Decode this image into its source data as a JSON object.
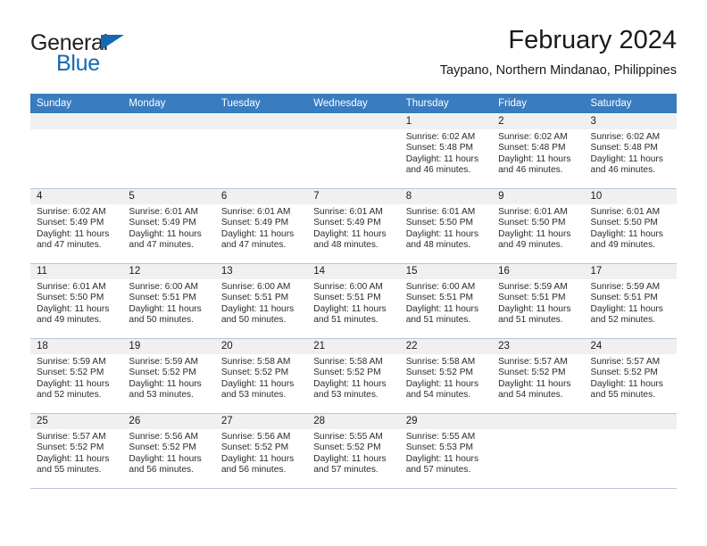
{
  "brand": {
    "name_part1": "General",
    "name_part2": "Blue",
    "triangle_icon": "brand-triangle-icon",
    "accent_color": "#1569b0"
  },
  "header": {
    "title": "February 2024",
    "subtitle": "Taypano, Northern Mindanao, Philippines"
  },
  "calendar": {
    "header_bg": "#3a7cc0",
    "daynum_bg": "#f0f0f0",
    "weekdays": [
      "Sunday",
      "Monday",
      "Tuesday",
      "Wednesday",
      "Thursday",
      "Friday",
      "Saturday"
    ],
    "weeks": [
      [
        {
          "day": "",
          "sunrise": "",
          "sunset": "",
          "daylight1": "",
          "daylight2": ""
        },
        {
          "day": "",
          "sunrise": "",
          "sunset": "",
          "daylight1": "",
          "daylight2": ""
        },
        {
          "day": "",
          "sunrise": "",
          "sunset": "",
          "daylight1": "",
          "daylight2": ""
        },
        {
          "day": "",
          "sunrise": "",
          "sunset": "",
          "daylight1": "",
          "daylight2": ""
        },
        {
          "day": "1",
          "sunrise": "Sunrise: 6:02 AM",
          "sunset": "Sunset: 5:48 PM",
          "daylight1": "Daylight: 11 hours",
          "daylight2": "and 46 minutes."
        },
        {
          "day": "2",
          "sunrise": "Sunrise: 6:02 AM",
          "sunset": "Sunset: 5:48 PM",
          "daylight1": "Daylight: 11 hours",
          "daylight2": "and 46 minutes."
        },
        {
          "day": "3",
          "sunrise": "Sunrise: 6:02 AM",
          "sunset": "Sunset: 5:48 PM",
          "daylight1": "Daylight: 11 hours",
          "daylight2": "and 46 minutes."
        }
      ],
      [
        {
          "day": "4",
          "sunrise": "Sunrise: 6:02 AM",
          "sunset": "Sunset: 5:49 PM",
          "daylight1": "Daylight: 11 hours",
          "daylight2": "and 47 minutes."
        },
        {
          "day": "5",
          "sunrise": "Sunrise: 6:01 AM",
          "sunset": "Sunset: 5:49 PM",
          "daylight1": "Daylight: 11 hours",
          "daylight2": "and 47 minutes."
        },
        {
          "day": "6",
          "sunrise": "Sunrise: 6:01 AM",
          "sunset": "Sunset: 5:49 PM",
          "daylight1": "Daylight: 11 hours",
          "daylight2": "and 47 minutes."
        },
        {
          "day": "7",
          "sunrise": "Sunrise: 6:01 AM",
          "sunset": "Sunset: 5:49 PM",
          "daylight1": "Daylight: 11 hours",
          "daylight2": "and 48 minutes."
        },
        {
          "day": "8",
          "sunrise": "Sunrise: 6:01 AM",
          "sunset": "Sunset: 5:50 PM",
          "daylight1": "Daylight: 11 hours",
          "daylight2": "and 48 minutes."
        },
        {
          "day": "9",
          "sunrise": "Sunrise: 6:01 AM",
          "sunset": "Sunset: 5:50 PM",
          "daylight1": "Daylight: 11 hours",
          "daylight2": "and 49 minutes."
        },
        {
          "day": "10",
          "sunrise": "Sunrise: 6:01 AM",
          "sunset": "Sunset: 5:50 PM",
          "daylight1": "Daylight: 11 hours",
          "daylight2": "and 49 minutes."
        }
      ],
      [
        {
          "day": "11",
          "sunrise": "Sunrise: 6:01 AM",
          "sunset": "Sunset: 5:50 PM",
          "daylight1": "Daylight: 11 hours",
          "daylight2": "and 49 minutes."
        },
        {
          "day": "12",
          "sunrise": "Sunrise: 6:00 AM",
          "sunset": "Sunset: 5:51 PM",
          "daylight1": "Daylight: 11 hours",
          "daylight2": "and 50 minutes."
        },
        {
          "day": "13",
          "sunrise": "Sunrise: 6:00 AM",
          "sunset": "Sunset: 5:51 PM",
          "daylight1": "Daylight: 11 hours",
          "daylight2": "and 50 minutes."
        },
        {
          "day": "14",
          "sunrise": "Sunrise: 6:00 AM",
          "sunset": "Sunset: 5:51 PM",
          "daylight1": "Daylight: 11 hours",
          "daylight2": "and 51 minutes."
        },
        {
          "day": "15",
          "sunrise": "Sunrise: 6:00 AM",
          "sunset": "Sunset: 5:51 PM",
          "daylight1": "Daylight: 11 hours",
          "daylight2": "and 51 minutes."
        },
        {
          "day": "16",
          "sunrise": "Sunrise: 5:59 AM",
          "sunset": "Sunset: 5:51 PM",
          "daylight1": "Daylight: 11 hours",
          "daylight2": "and 51 minutes."
        },
        {
          "day": "17",
          "sunrise": "Sunrise: 5:59 AM",
          "sunset": "Sunset: 5:51 PM",
          "daylight1": "Daylight: 11 hours",
          "daylight2": "and 52 minutes."
        }
      ],
      [
        {
          "day": "18",
          "sunrise": "Sunrise: 5:59 AM",
          "sunset": "Sunset: 5:52 PM",
          "daylight1": "Daylight: 11 hours",
          "daylight2": "and 52 minutes."
        },
        {
          "day": "19",
          "sunrise": "Sunrise: 5:59 AM",
          "sunset": "Sunset: 5:52 PM",
          "daylight1": "Daylight: 11 hours",
          "daylight2": "and 53 minutes."
        },
        {
          "day": "20",
          "sunrise": "Sunrise: 5:58 AM",
          "sunset": "Sunset: 5:52 PM",
          "daylight1": "Daylight: 11 hours",
          "daylight2": "and 53 minutes."
        },
        {
          "day": "21",
          "sunrise": "Sunrise: 5:58 AM",
          "sunset": "Sunset: 5:52 PM",
          "daylight1": "Daylight: 11 hours",
          "daylight2": "and 53 minutes."
        },
        {
          "day": "22",
          "sunrise": "Sunrise: 5:58 AM",
          "sunset": "Sunset: 5:52 PM",
          "daylight1": "Daylight: 11 hours",
          "daylight2": "and 54 minutes."
        },
        {
          "day": "23",
          "sunrise": "Sunrise: 5:57 AM",
          "sunset": "Sunset: 5:52 PM",
          "daylight1": "Daylight: 11 hours",
          "daylight2": "and 54 minutes."
        },
        {
          "day": "24",
          "sunrise": "Sunrise: 5:57 AM",
          "sunset": "Sunset: 5:52 PM",
          "daylight1": "Daylight: 11 hours",
          "daylight2": "and 55 minutes."
        }
      ],
      [
        {
          "day": "25",
          "sunrise": "Sunrise: 5:57 AM",
          "sunset": "Sunset: 5:52 PM",
          "daylight1": "Daylight: 11 hours",
          "daylight2": "and 55 minutes."
        },
        {
          "day": "26",
          "sunrise": "Sunrise: 5:56 AM",
          "sunset": "Sunset: 5:52 PM",
          "daylight1": "Daylight: 11 hours",
          "daylight2": "and 56 minutes."
        },
        {
          "day": "27",
          "sunrise": "Sunrise: 5:56 AM",
          "sunset": "Sunset: 5:52 PM",
          "daylight1": "Daylight: 11 hours",
          "daylight2": "and 56 minutes."
        },
        {
          "day": "28",
          "sunrise": "Sunrise: 5:55 AM",
          "sunset": "Sunset: 5:52 PM",
          "daylight1": "Daylight: 11 hours",
          "daylight2": "and 57 minutes."
        },
        {
          "day": "29",
          "sunrise": "Sunrise: 5:55 AM",
          "sunset": "Sunset: 5:53 PM",
          "daylight1": "Daylight: 11 hours",
          "daylight2": "and 57 minutes."
        },
        {
          "day": "",
          "sunrise": "",
          "sunset": "",
          "daylight1": "",
          "daylight2": ""
        },
        {
          "day": "",
          "sunrise": "",
          "sunset": "",
          "daylight1": "",
          "daylight2": ""
        }
      ]
    ]
  }
}
